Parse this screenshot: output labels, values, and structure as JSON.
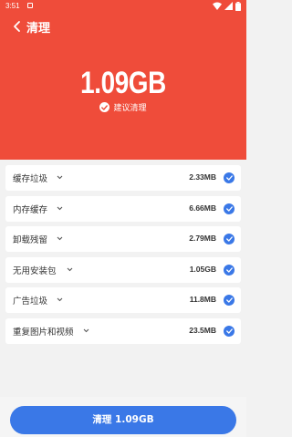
{
  "status_bar": {
    "time": "3:51"
  },
  "header": {
    "title": "清理",
    "total_size": "1.09GB",
    "suggest_label": "建议清理",
    "background_color": "#ef4c3a"
  },
  "items": [
    {
      "label": "缓存垃圾",
      "size": "2.33MB",
      "checked": true
    },
    {
      "label": "内存缓存",
      "size": "6.66MB",
      "checked": true
    },
    {
      "label": "卸载残留",
      "size": "2.79MB",
      "checked": true
    },
    {
      "label": "无用安装包",
      "size": "1.05GB",
      "checked": true
    },
    {
      "label": "广告垃圾",
      "size": "11.8MB",
      "checked": true
    },
    {
      "label": "重复图片和视频",
      "size": "23.5MB",
      "checked": true
    }
  ],
  "clean_button": {
    "label": "清理 1.09GB",
    "color": "#3a78e7"
  },
  "icons": {
    "back": "chevron-left-icon",
    "expand": "chevron-down-icon",
    "check": "check-circle-icon"
  }
}
